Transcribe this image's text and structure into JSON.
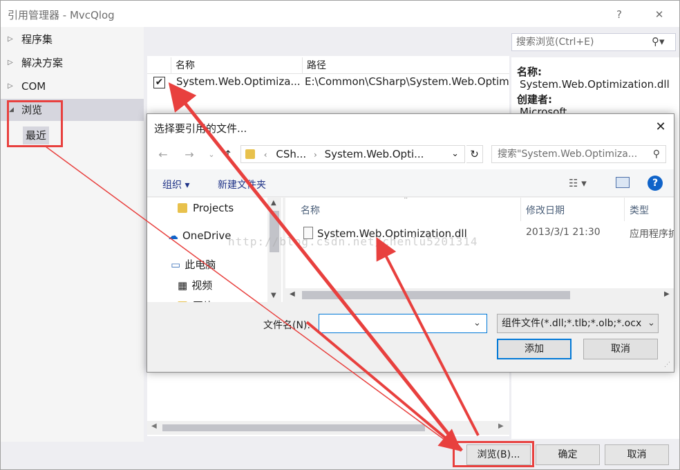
{
  "window": {
    "title": "引用管理器 - MvcQlog",
    "help_glyph": "?",
    "close_glyph": "✕"
  },
  "sidebar": {
    "items": [
      {
        "label": "程序集",
        "arrow": "▷"
      },
      {
        "label": "解决方案",
        "arrow": "▷"
      },
      {
        "label": "COM",
        "arrow": "▷"
      },
      {
        "label": "浏览",
        "arrow": "◢"
      }
    ],
    "sub_item": "最近"
  },
  "list": {
    "headers": [
      "名称",
      "路径"
    ],
    "rows": [
      {
        "checked": true,
        "name": "System.Web.Optimiza...",
        "path": "E:\\Common\\CSharp\\System.Web.Optimiz"
      }
    ]
  },
  "search": {
    "placeholder": "搜索浏览(Ctrl+E)",
    "icon": "search-icon"
  },
  "details": {
    "name_label": "名称:",
    "name_value": "System.Web.Optimization.dll",
    "creator_label": "创建者:",
    "creator_value": "Microsoft"
  },
  "buttons": {
    "browse": "浏览(B)...",
    "ok": "确定",
    "cancel": "取消"
  },
  "file_dialog": {
    "title": "选择要引用的文件...",
    "close_glyph": "✕",
    "address": {
      "parts": [
        "CSh...",
        "System.Web.Opti..."
      ]
    },
    "search_placeholder": "搜索\"System.Web.Optimiza...",
    "toolbar": {
      "organize": "组织 ▾",
      "new_folder": "新建文件夹"
    },
    "nav_items": [
      "Projects",
      "OneDrive",
      "此电脑",
      "视频",
      "图片"
    ],
    "columns": [
      "名称",
      "修改日期",
      "类型"
    ],
    "files": [
      {
        "name": "System.Web.Optimization.dll",
        "modified": "2013/3/1 21:30",
        "type": "应用程序扩"
      }
    ],
    "filename_label": "文件名(N):",
    "filename_value": "",
    "filter": "组件文件(*.dll;*.tlb;*.olb;*.ocx",
    "add_button": "添加",
    "cancel_button": "取消"
  },
  "watermark": "http://blog.csdn.net/chenlu5201314",
  "colors": {
    "annotation_red": "#e8403e",
    "accent_blue": "#0078d7",
    "sidebar_selected": "#d6d6de"
  }
}
